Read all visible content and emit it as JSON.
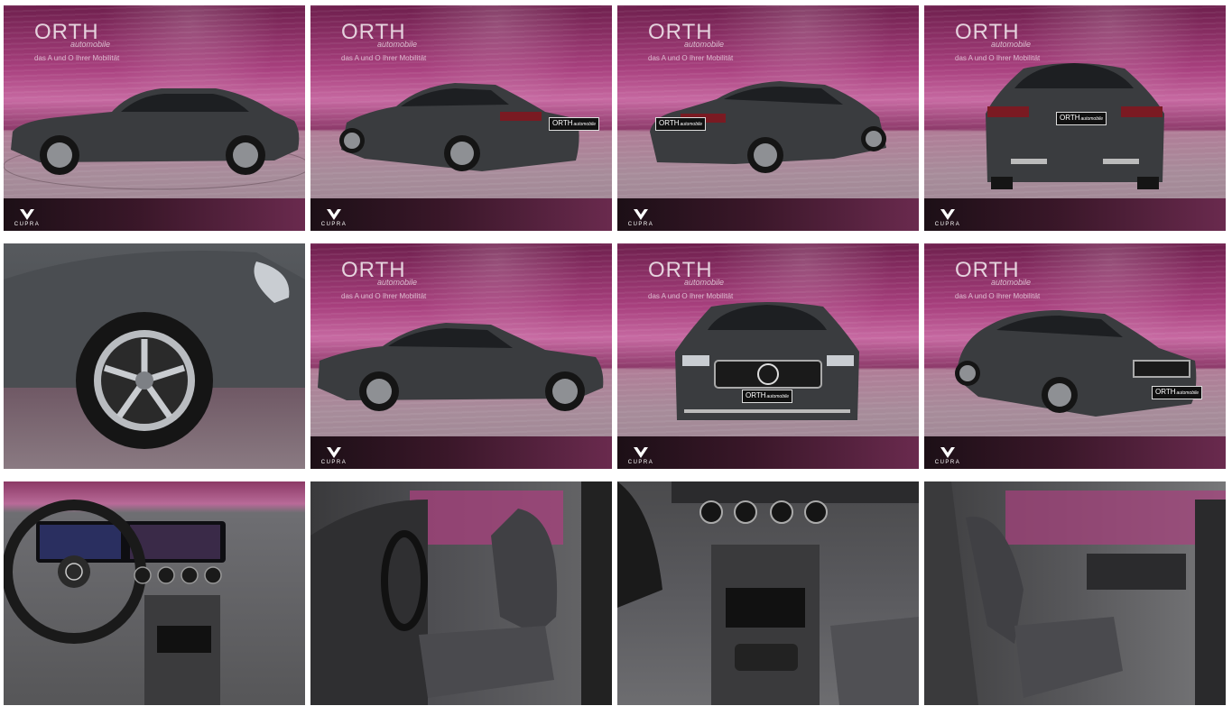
{
  "photos": [
    {
      "id": "exterior-side-left",
      "studio": true,
      "has_logo": true
    },
    {
      "id": "exterior-rear-left",
      "studio": true,
      "has_logo": true
    },
    {
      "id": "exterior-rear-right",
      "studio": true,
      "has_logo": true
    },
    {
      "id": "exterior-rear",
      "studio": true,
      "has_logo": true
    },
    {
      "id": "wheel-closeup",
      "studio": false,
      "has_logo": false
    },
    {
      "id": "exterior-side-right",
      "studio": true,
      "has_logo": true
    },
    {
      "id": "exterior-front",
      "studio": true,
      "has_logo": true
    },
    {
      "id": "exterior-front-right",
      "studio": true,
      "has_logo": true
    },
    {
      "id": "interior-cockpit",
      "studio": false,
      "has_logo": false
    },
    {
      "id": "interior-driver-seat",
      "studio": false,
      "has_logo": false
    },
    {
      "id": "interior-center-console",
      "studio": false,
      "has_logo": false
    },
    {
      "id": "interior-passenger-seat",
      "studio": false,
      "has_logo": false
    }
  ],
  "dealer": {
    "logo_text": "ORTH",
    "logo_sub": "automobile",
    "tagline": "das A und O Ihrer Mobilität",
    "plate_text": "ORTH",
    "plate_sub": "automobile"
  },
  "brand_footer": {
    "label": "CUPRA"
  },
  "colors": {
    "studio_magenta": "#a8407e",
    "studio_floor": "#a78c9a",
    "car_body": "#3d3f42",
    "footer_dark": "#1c0f16"
  }
}
